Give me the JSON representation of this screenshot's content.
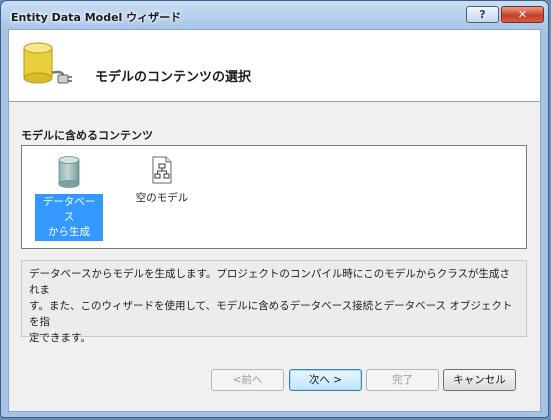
{
  "window": {
    "title": "Entity Data Model ウィザード",
    "help_label": "?",
    "close_label": "✕"
  },
  "header": {
    "title": "モデルのコンテンツの選択",
    "icon": "database-plug-icon"
  },
  "contents": {
    "label": "モデルに含めるコンテンツ",
    "items": [
      {
        "label_line1": "データベース",
        "label_line2": "から生成",
        "icon": "database-icon",
        "selected": true
      },
      {
        "label_line1": "空のモデル",
        "icon": "empty-model-icon",
        "selected": false
      }
    ]
  },
  "description": {
    "line1": "データベースからモデルを生成します。プロジェクトのコンパイル時にこのモデルからクラスが生成されま",
    "line2": "す。また、このウィザードを使用して、モデルに含めるデータベース接続とデータベース オブジェクトを指",
    "line3": "定できます。"
  },
  "buttons": {
    "prev": "<前へ",
    "next": "次へ >",
    "finish": "完了",
    "cancel": "キャンセル"
  },
  "colors": {
    "selection": "#3399ff",
    "titlebar": "#a6c3e6"
  }
}
